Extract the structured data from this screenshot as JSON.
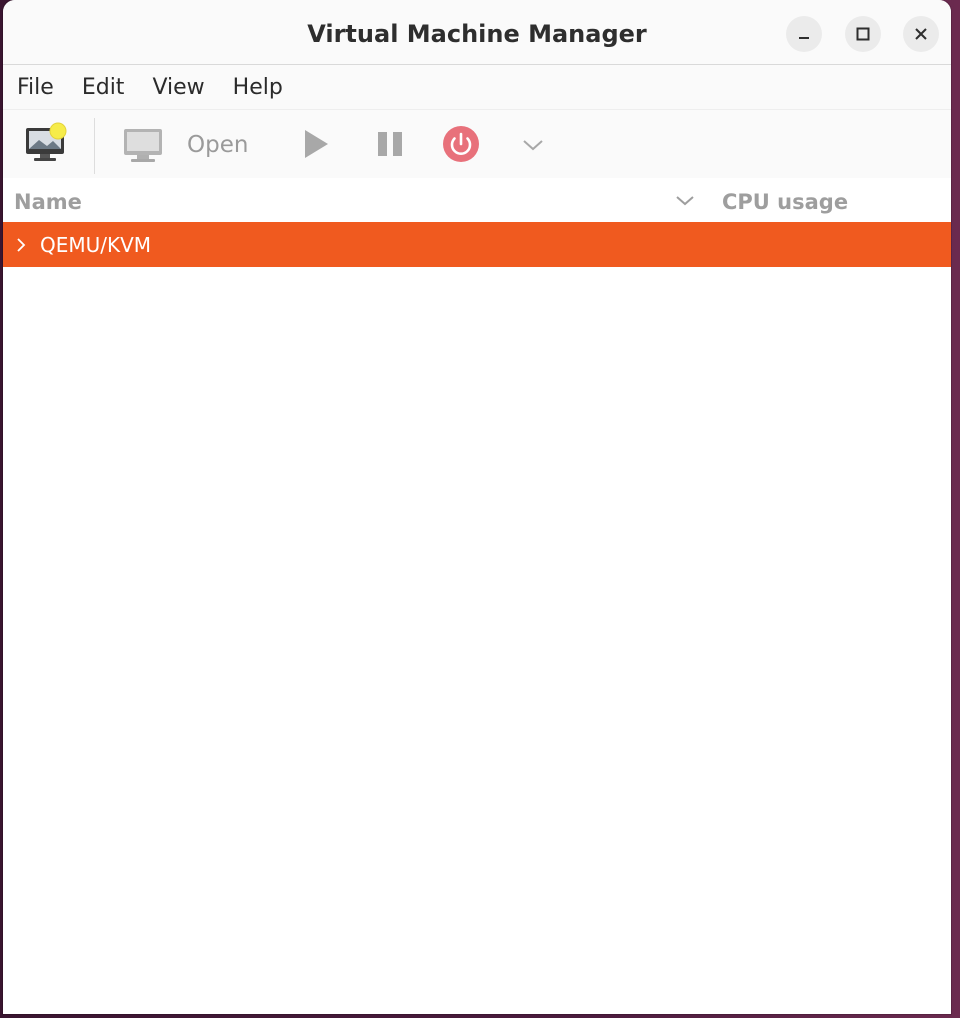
{
  "window": {
    "title": "Virtual Machine Manager"
  },
  "window_controls": {
    "minimize_icon": "minimize-icon",
    "maximize_icon": "maximize-icon",
    "close_icon": "close-icon"
  },
  "menubar": {
    "items": [
      "File",
      "Edit",
      "View",
      "Help"
    ]
  },
  "toolbar": {
    "new_vm_icon": "new-vm-icon",
    "open_icon": "monitor-icon",
    "open_label": "Open",
    "run_icon": "play-icon",
    "pause_icon": "pause-icon",
    "shutdown_icon": "power-icon",
    "shutdown_menu_icon": "chevron-down-icon"
  },
  "list": {
    "columns": {
      "name": "Name",
      "cpu": "CPU usage"
    },
    "rows": [
      {
        "label": "QEMU/KVM",
        "selected": true
      }
    ]
  },
  "colors": {
    "selection": "#f05a1f",
    "power_button": "#e8717b",
    "disabled_text": "#9a9a9a"
  }
}
